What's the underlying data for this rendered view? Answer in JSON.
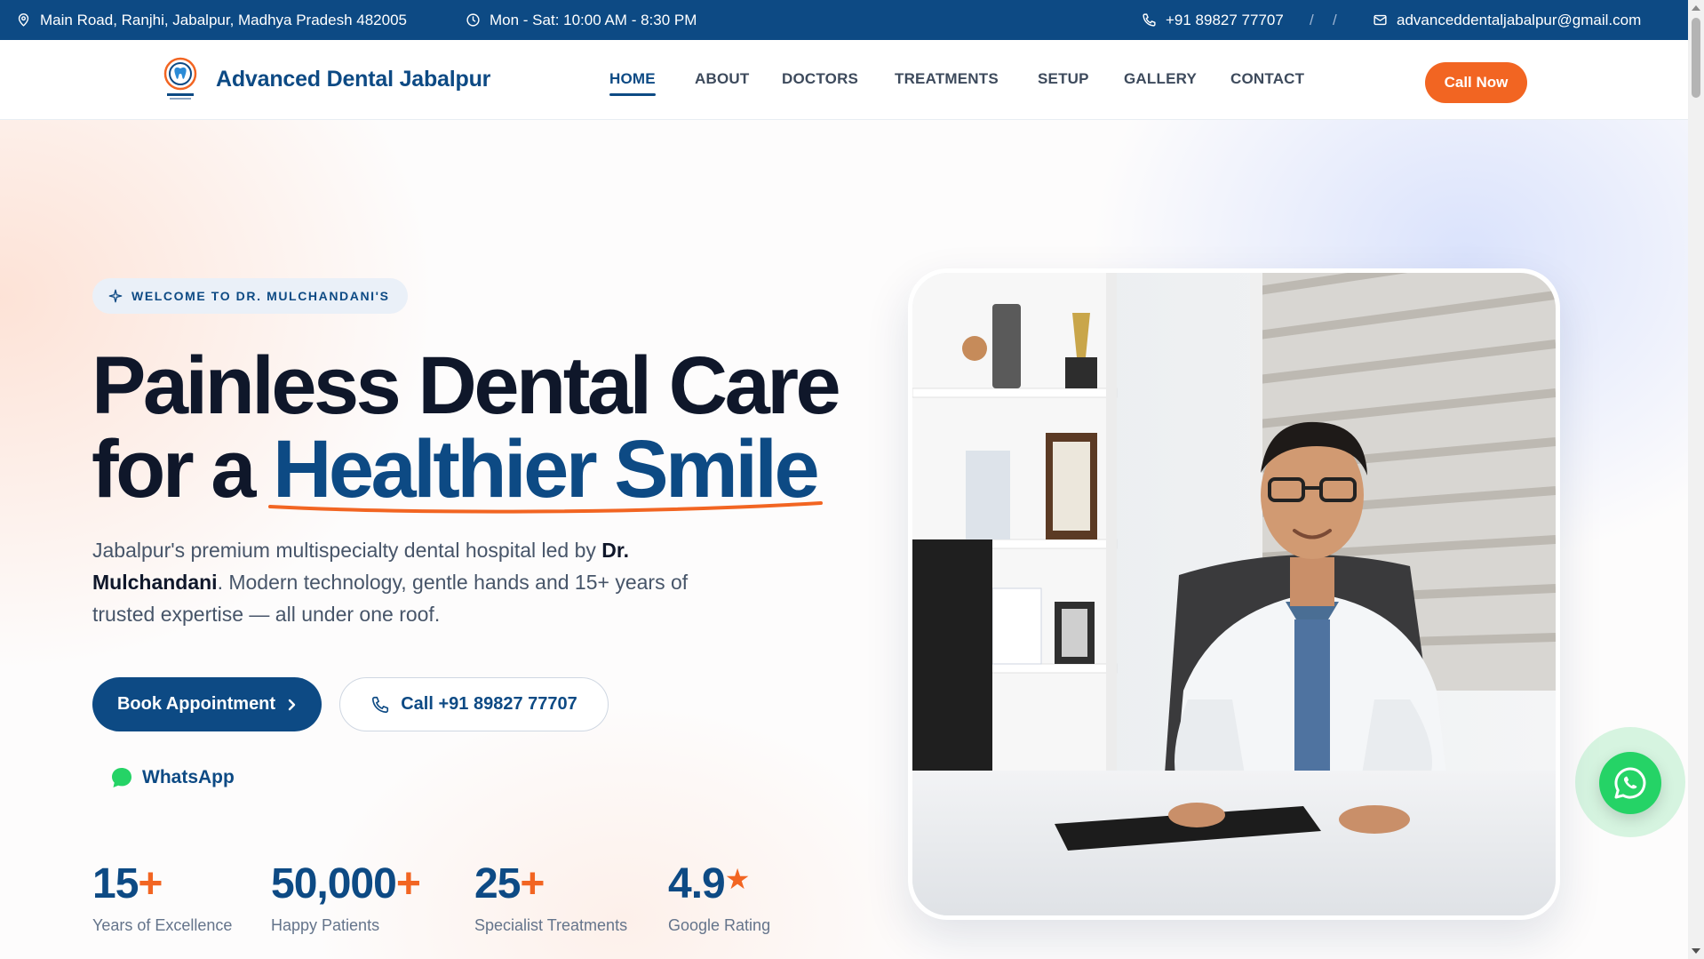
{
  "topbar": {
    "address": "Main Road, Ranjhi, Jabalpur, Madhya Pradesh 482005",
    "hours": "Mon - Sat: 10:00 AM - 8:30 PM",
    "phone": "+91 89827 77707",
    "separator": "/",
    "email": "advanceddentaljabalpur@gmail.com",
    "icons": [
      "map-pin-icon",
      "clock-icon",
      "phone-icon",
      "mail-icon"
    ]
  },
  "header": {
    "brand": "Advanced Dental Jabalpur",
    "nav": [
      {
        "label": "HOME",
        "active": true
      },
      {
        "label": "ABOUT"
      },
      {
        "label": "DOCTORS"
      },
      {
        "label": "TREATMENTS"
      },
      {
        "label": "SETUP"
      },
      {
        "label": "GALLERY"
      },
      {
        "label": "CONTACT"
      }
    ],
    "cta": "Call Now"
  },
  "hero": {
    "badge": "WELCOME TO DR. MULCHANDANI'S",
    "title_line1": "Painless Dental Care",
    "title_line2_prefix": "for a",
    "title_line2_accent": "Healthier Smile",
    "lead_part1": "Jabalpur's premium multispecialty dental hospital led by",
    "lead_bold": "Dr. Mulchandani",
    "lead_part2": ". Modern technology, gentle hands and 15+ years of trusted expertise — all under one roof.",
    "book_button": "Book Appointment",
    "call_button": "Call +91 89827 77707",
    "whatsapp_link": "WhatsApp",
    "stats": [
      {
        "value": "15",
        "suffix": "+",
        "label": "Years of Excellence"
      },
      {
        "value": "50,000",
        "suffix": "+",
        "label": "Happy Patients"
      },
      {
        "value": "25",
        "suffix": "+",
        "label": "Specialist Treatments"
      },
      {
        "value": "4.9",
        "suffix": "★",
        "label": "Google Rating"
      }
    ]
  },
  "colors": {
    "primary": "#0d4a84",
    "accent": "#f26522",
    "whatsapp": "#25d366",
    "heading": "#0f172a"
  }
}
